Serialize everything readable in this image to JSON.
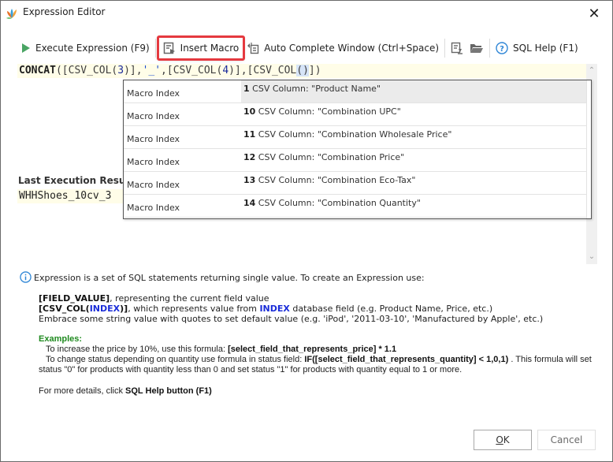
{
  "window": {
    "title": "Expression Editor",
    "close_symbol": "✕"
  },
  "toolbar": {
    "execute_label": "Execute Expression (F9)",
    "insert_macro_label": "Insert Macro",
    "autocomplete_label": "Auto Complete Window (Ctrl+Space)",
    "sql_help_label": "SQL Help (F1)",
    "highlight_color": "#e5393f"
  },
  "editor": {
    "expression_parts": {
      "func": "CONCAT",
      "p1": "([CSV_COL(",
      "n1": "3",
      "p2": ")],",
      "s1": "'_'",
      "p3": ",[CSV_COL(",
      "n2": "4",
      "p4": ")],[CSV_COL",
      "sel": "()",
      "p5": "])"
    },
    "scroll_up": "⌃",
    "scroll_down": "⌄"
  },
  "result": {
    "label": "Last Execution Result:",
    "value": "WHHShoes_10cv_3"
  },
  "macro_popup": {
    "rows": [
      {
        "label": "Macro Index",
        "index": "1",
        "text": " CSV Column: \"Product Name\"",
        "selected": true
      },
      {
        "label": "Macro Index",
        "index": "10",
        "text": " CSV Column: \"Combination UPC\""
      },
      {
        "label": "Macro Index",
        "index": "11",
        "text": " CSV Column: \"Combination Wholesale Price\""
      },
      {
        "label": "Macro Index",
        "index": "12",
        "text": " CSV Column: \"Combination Price\""
      },
      {
        "label": "Macro Index",
        "index": "13",
        "text": " CSV Column: \"Combination Eco-Tax\""
      },
      {
        "label": "Macro Index",
        "index": "14",
        "text": " CSV Column: \"Combination Quantity\""
      }
    ]
  },
  "help": {
    "intro": "Expression is a set of SQL statements returning single value. To create an Expression use:",
    "field_value_token": "[FIELD_VALUE]",
    "field_value_desc": ", representing the current field value",
    "csv_col_open": "[CSV_COL(",
    "csv_col_index": "INDEX",
    "csv_col_close": ")]",
    "csv_col_desc1": ", which represents value from ",
    "csv_col_index2": "INDEX",
    "csv_col_desc2": " database field (e.g. Product Name, Price, etc.)",
    "embrace": "Embrace some string value with quotes to set default value (e.g. 'iPod', '2011-03-10', 'Manufactured by Apple', etc.)",
    "examples_title": "Examples:",
    "ex1_text": "   To increase the price by 10%, use this formula: ",
    "ex1_formula": "[select_field_that_represents_price] * 1.1",
    "ex2_text": "   To change status depending on quantity use formula in status field: ",
    "ex2_formula": "IF([select_field_that_represents_quantity] < 1,0,1)",
    "ex2_rest": " . This formula will set status \"0\" for products with quantity less than 0 and set status \"1\" for products with quantity equal to 1 or more.",
    "more_text": "For more details, click ",
    "more_bold": "SQL Help button (F1)"
  },
  "buttons": {
    "ok_mnemonic": "O",
    "ok_rest": "K",
    "cancel": "Cancel"
  }
}
